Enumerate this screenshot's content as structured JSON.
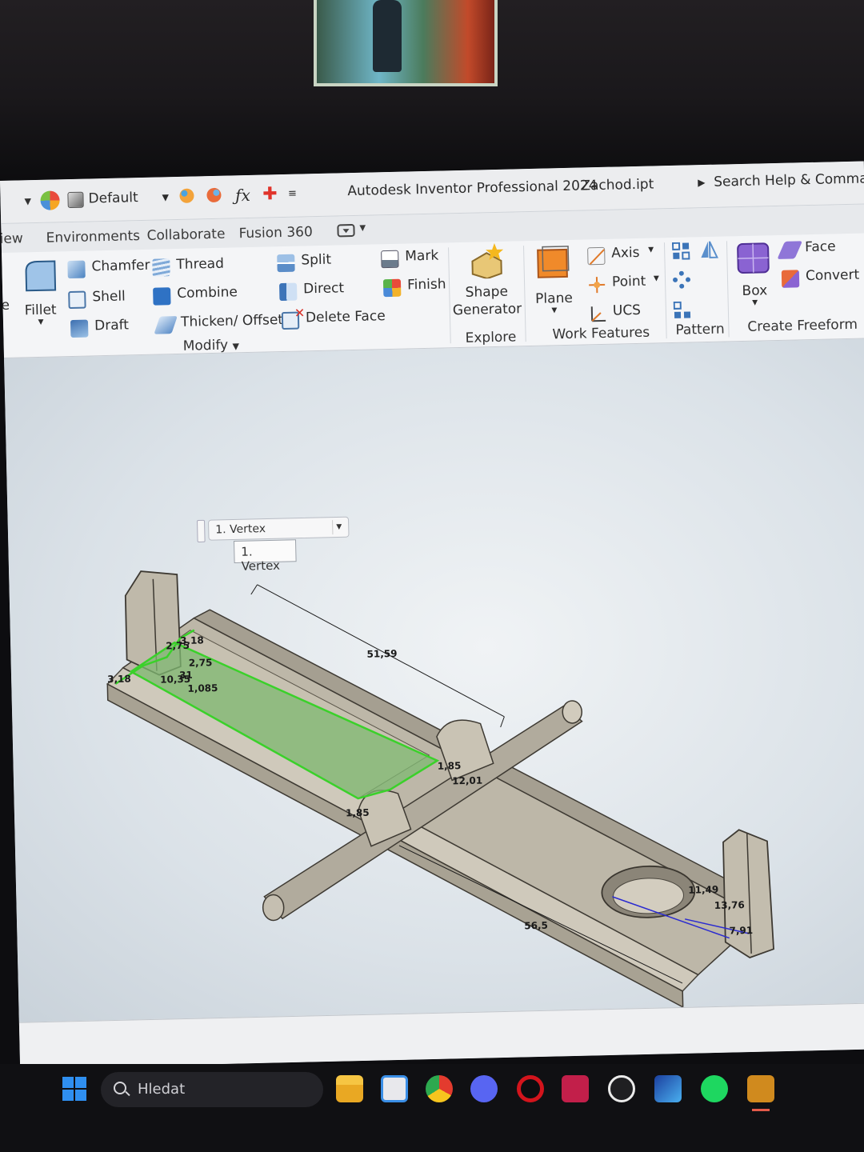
{
  "titlebar": {
    "appearance": "Default",
    "app_title": "Autodesk Inventor Professional 2024",
    "file_name": "Zachod.ipt",
    "search": "Search Help & Comman"
  },
  "tabs": [
    "iew",
    "Environments",
    "Collaborate",
    "Fusion 360"
  ],
  "ribbon": {
    "fillet": "Fillet",
    "edge_left": "e",
    "modify": {
      "chamfer": "Chamfer",
      "thread": "Thread",
      "split": "Split",
      "mark": "Mark",
      "shell": "Shell",
      "combine": "Combine",
      "direct": "Direct",
      "finish": "Finish",
      "draft": "Draft",
      "thicken_offset": "Thicken/ Offset",
      "delete_face": "Delete Face",
      "group_label": "Modify"
    },
    "explore": {
      "shape_generator_line1": "Shape",
      "shape_generator_line2": "Generator",
      "group_label": "Explore"
    },
    "work_features": {
      "plane": "Plane",
      "axis": "Axis",
      "point": "Point",
      "ucs": "UCS",
      "group_label": "Work Features"
    },
    "pattern": {
      "group_label": "Pattern"
    },
    "create_freeform": {
      "box": "Box",
      "face": "Face",
      "convert": "Convert",
      "group_label": "Create Freeform"
    }
  },
  "viewport": {
    "dimensions": {
      "d5159": "51,59",
      "d275a": "2,75",
      "d275b": "2,75",
      "d318a": "3,18",
      "d318b": "3,18",
      "d1035": "10,35",
      "d31": "31",
      "d1085": "1,085",
      "d185a": "1,85",
      "d1201": "12,01",
      "d185b": "1,85",
      "d1149": "11,49",
      "d1376": "13,76",
      "d791": "7,91",
      "d565": "56,5"
    },
    "selection_combo": "1. Vertex",
    "tooltip": "1. Vertex"
  },
  "taskbar": {
    "search_label": "Hledat"
  }
}
